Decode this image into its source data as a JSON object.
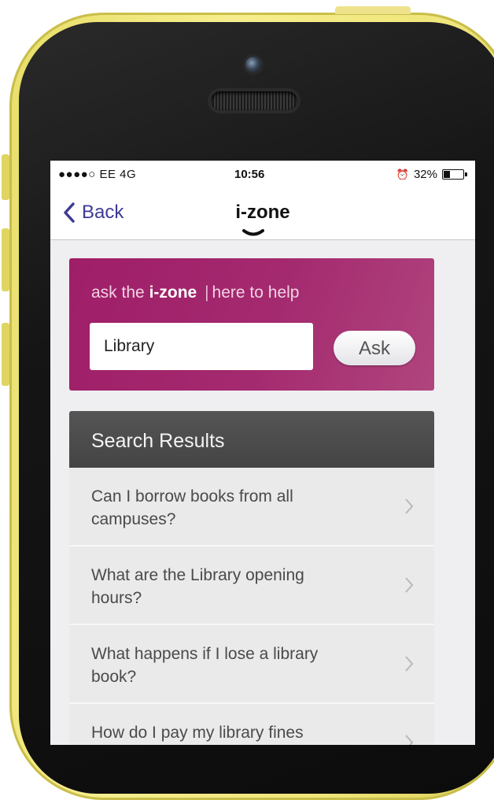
{
  "status_bar": {
    "carrier": "●●●●○ EE   4G",
    "time": "10:56",
    "battery": "32%",
    "battery_level": 0.32,
    "alarm_icon": "alarm-clock-icon"
  },
  "nav": {
    "back_label": "Back",
    "title": "i-zone"
  },
  "ask_panel": {
    "prefix": "ask the",
    "brand": "i-zone",
    "separator": "|",
    "suffix": "here to help",
    "search_value": "Library",
    "ask_label": "Ask"
  },
  "results": {
    "header": "Search Results",
    "items": [
      {
        "question": "Can I borrow books from all campuses?"
      },
      {
        "question": "What are the Library opening hours?"
      },
      {
        "question": "What happens if I lose a library book?"
      },
      {
        "question": "How do I pay my library fines"
      }
    ]
  },
  "colors": {
    "accent": "#a4286f",
    "back_link": "#3e3b96",
    "phone_case": "#f3ea86",
    "results_header": "#4a4a4a"
  }
}
